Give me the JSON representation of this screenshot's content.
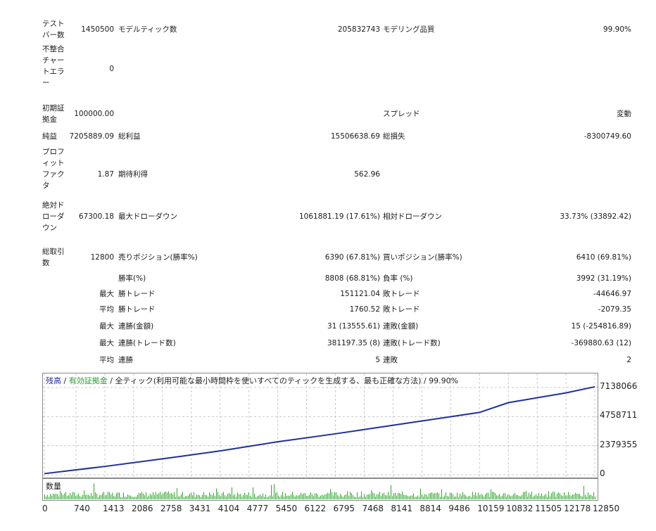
{
  "stats": {
    "test_bars_label": "テストバー数",
    "test_bars_value": "1450500",
    "modeled_ticks_label": "モデルティック数",
    "modeled_ticks_value": "205832743",
    "modeling_quality_label": "モデリング品質",
    "modeling_quality_value": "99.90%",
    "mismatch_label": "不整合チャートエラー",
    "mismatch_value": "0",
    "initial_deposit_label": "初期証拠金",
    "initial_deposit_value": "100000.00",
    "spread_label": "スプレッド",
    "spread_value": "変動",
    "net_profit_label": "純益",
    "net_profit_value": "7205889.09",
    "gross_profit_label": "総利益",
    "gross_profit_value": "15506638.69",
    "gross_loss_label": "総損失",
    "gross_loss_value": "-8300749.60",
    "profit_factor_label": "プロフィットファクタ",
    "profit_factor_value": "1.87",
    "expected_payoff_label": "期待利得",
    "expected_payoff_value": "562.96",
    "abs_drawdown_label": "絶対ドローダウン",
    "abs_drawdown_value": "67300.18",
    "max_drawdown_label": "最大ドローダウン",
    "max_drawdown_value": "1061881.19 (17.61%)",
    "rel_drawdown_label": "相対ドローダウン",
    "rel_drawdown_value": "33.73% (33892.42)",
    "total_trades_label": "総取引数",
    "total_trades_value": "12800",
    "short_label": "売りポジション(勝率%)",
    "short_value": "6390 (67.81%)",
    "long_label": "買いポジション(勝率%)",
    "long_value": "6410 (69.81%)",
    "win_rate_label": "勝率(%)",
    "win_rate_value": "8808 (68.81%)",
    "loss_rate_label": "負率 (%)",
    "loss_rate_value": "3992 (31.19%)",
    "max_label_1": "最大",
    "largest_win_label": "勝トレード",
    "largest_win_value": "151121.04",
    "largest_loss_label": "敗トレード",
    "largest_loss_value": "-44646.97",
    "avg_label_1": "平均",
    "avg_win_label": "勝トレード",
    "avg_win_value": "1760.52",
    "avg_loss_label": "敗トレード",
    "avg_loss_value": "-2079.35",
    "max_label_2": "最大",
    "consec_wins_amt_label": "連勝(金額)",
    "consec_wins_amt_value": "31 (13555.61)",
    "consec_losses_amt_label": "連敗(金額)",
    "consec_losses_amt_value": "15 (-254816.89)",
    "max_label_3": "最大",
    "consec_wins_cnt_label": "連勝(トレード数)",
    "consec_wins_cnt_value": "381197.35 (8)",
    "consec_losses_cnt_label": "連敗(トレード数)",
    "consec_losses_cnt_value": "-369880.63 (12)",
    "avg_label_2": "平均",
    "avg_consec_wins_label": "連勝",
    "avg_consec_wins_value": "5",
    "avg_consec_losses_label": "連敗",
    "avg_consec_losses_value": "2"
  },
  "chart_title": {
    "balance": "残高",
    "sep1": " / ",
    "equity": "有効証拠金",
    "rest": " / 全ティック(利用可能な最小時間枠を使いすべてのティックを生成する、最も正確な方法) / 99.90%"
  },
  "colors": {
    "balance": "#1f2fa0",
    "equity": "#2a9d2a",
    "volume": "#2ea82e",
    "grid": "#c8c8c8"
  },
  "volume_label": "数量",
  "chart_data": {
    "type": "line",
    "series": [
      {
        "name": "残高",
        "x": [
          0,
          1413,
          2758,
          4104,
          5450,
          6795,
          8141,
          9486,
          10159,
          10832,
          12178,
          12850
        ],
        "values": [
          90000,
          680000,
          1300000,
          1950000,
          2700000,
          3350000,
          4050000,
          4750000,
          5100000,
          5900000,
          6700000,
          7200000
        ]
      }
    ],
    "y_ticks": [
      "7138066",
      "4758711",
      "2379355",
      "0"
    ],
    "y_tick_values": [
      7138066,
      4758711,
      2379355,
      0
    ],
    "x_ticks": [
      "0",
      "740",
      "1413",
      "2086",
      "2758",
      "3431",
      "4104",
      "4777",
      "5450",
      "6122",
      "6795",
      "7468",
      "8141",
      "8814",
      "9486",
      "10159",
      "10832",
      "11505",
      "12178",
      "12850"
    ],
    "xlim": [
      0,
      12850
    ],
    "ylim": [
      0,
      7138066
    ],
    "grid": true
  }
}
